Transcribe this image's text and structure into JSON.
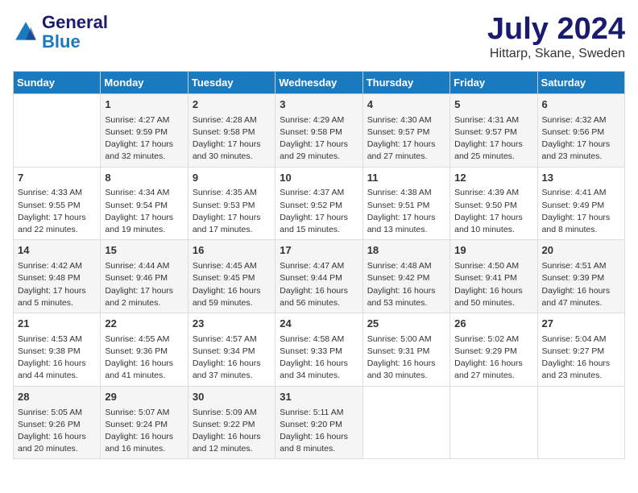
{
  "header": {
    "logo_line1": "General",
    "logo_line2": "Blue",
    "month_title": "July 2024",
    "location": "Hittarp, Skane, Sweden"
  },
  "days_of_week": [
    "Sunday",
    "Monday",
    "Tuesday",
    "Wednesday",
    "Thursday",
    "Friday",
    "Saturday"
  ],
  "weeks": [
    [
      {
        "day": "",
        "info": ""
      },
      {
        "day": "1",
        "info": "Sunrise: 4:27 AM\nSunset: 9:59 PM\nDaylight: 17 hours and 32 minutes."
      },
      {
        "day": "2",
        "info": "Sunrise: 4:28 AM\nSunset: 9:58 PM\nDaylight: 17 hours and 30 minutes."
      },
      {
        "day": "3",
        "info": "Sunrise: 4:29 AM\nSunset: 9:58 PM\nDaylight: 17 hours and 29 minutes."
      },
      {
        "day": "4",
        "info": "Sunrise: 4:30 AM\nSunset: 9:57 PM\nDaylight: 17 hours and 27 minutes."
      },
      {
        "day": "5",
        "info": "Sunrise: 4:31 AM\nSunset: 9:57 PM\nDaylight: 17 hours and 25 minutes."
      },
      {
        "day": "6",
        "info": "Sunrise: 4:32 AM\nSunset: 9:56 PM\nDaylight: 17 hours and 23 minutes."
      }
    ],
    [
      {
        "day": "7",
        "info": "Sunrise: 4:33 AM\nSunset: 9:55 PM\nDaylight: 17 hours and 22 minutes."
      },
      {
        "day": "8",
        "info": "Sunrise: 4:34 AM\nSunset: 9:54 PM\nDaylight: 17 hours and 19 minutes."
      },
      {
        "day": "9",
        "info": "Sunrise: 4:35 AM\nSunset: 9:53 PM\nDaylight: 17 hours and 17 minutes."
      },
      {
        "day": "10",
        "info": "Sunrise: 4:37 AM\nSunset: 9:52 PM\nDaylight: 17 hours and 15 minutes."
      },
      {
        "day": "11",
        "info": "Sunrise: 4:38 AM\nSunset: 9:51 PM\nDaylight: 17 hours and 13 minutes."
      },
      {
        "day": "12",
        "info": "Sunrise: 4:39 AM\nSunset: 9:50 PM\nDaylight: 17 hours and 10 minutes."
      },
      {
        "day": "13",
        "info": "Sunrise: 4:41 AM\nSunset: 9:49 PM\nDaylight: 17 hours and 8 minutes."
      }
    ],
    [
      {
        "day": "14",
        "info": "Sunrise: 4:42 AM\nSunset: 9:48 PM\nDaylight: 17 hours and 5 minutes."
      },
      {
        "day": "15",
        "info": "Sunrise: 4:44 AM\nSunset: 9:46 PM\nDaylight: 17 hours and 2 minutes."
      },
      {
        "day": "16",
        "info": "Sunrise: 4:45 AM\nSunset: 9:45 PM\nDaylight: 16 hours and 59 minutes."
      },
      {
        "day": "17",
        "info": "Sunrise: 4:47 AM\nSunset: 9:44 PM\nDaylight: 16 hours and 56 minutes."
      },
      {
        "day": "18",
        "info": "Sunrise: 4:48 AM\nSunset: 9:42 PM\nDaylight: 16 hours and 53 minutes."
      },
      {
        "day": "19",
        "info": "Sunrise: 4:50 AM\nSunset: 9:41 PM\nDaylight: 16 hours and 50 minutes."
      },
      {
        "day": "20",
        "info": "Sunrise: 4:51 AM\nSunset: 9:39 PM\nDaylight: 16 hours and 47 minutes."
      }
    ],
    [
      {
        "day": "21",
        "info": "Sunrise: 4:53 AM\nSunset: 9:38 PM\nDaylight: 16 hours and 44 minutes."
      },
      {
        "day": "22",
        "info": "Sunrise: 4:55 AM\nSunset: 9:36 PM\nDaylight: 16 hours and 41 minutes."
      },
      {
        "day": "23",
        "info": "Sunrise: 4:57 AM\nSunset: 9:34 PM\nDaylight: 16 hours and 37 minutes."
      },
      {
        "day": "24",
        "info": "Sunrise: 4:58 AM\nSunset: 9:33 PM\nDaylight: 16 hours and 34 minutes."
      },
      {
        "day": "25",
        "info": "Sunrise: 5:00 AM\nSunset: 9:31 PM\nDaylight: 16 hours and 30 minutes."
      },
      {
        "day": "26",
        "info": "Sunrise: 5:02 AM\nSunset: 9:29 PM\nDaylight: 16 hours and 27 minutes."
      },
      {
        "day": "27",
        "info": "Sunrise: 5:04 AM\nSunset: 9:27 PM\nDaylight: 16 hours and 23 minutes."
      }
    ],
    [
      {
        "day": "28",
        "info": "Sunrise: 5:05 AM\nSunset: 9:26 PM\nDaylight: 16 hours and 20 minutes."
      },
      {
        "day": "29",
        "info": "Sunrise: 5:07 AM\nSunset: 9:24 PM\nDaylight: 16 hours and 16 minutes."
      },
      {
        "day": "30",
        "info": "Sunrise: 5:09 AM\nSunset: 9:22 PM\nDaylight: 16 hours and 12 minutes."
      },
      {
        "day": "31",
        "info": "Sunrise: 5:11 AM\nSunset: 9:20 PM\nDaylight: 16 hours and 8 minutes."
      },
      {
        "day": "",
        "info": ""
      },
      {
        "day": "",
        "info": ""
      },
      {
        "day": "",
        "info": ""
      }
    ]
  ]
}
